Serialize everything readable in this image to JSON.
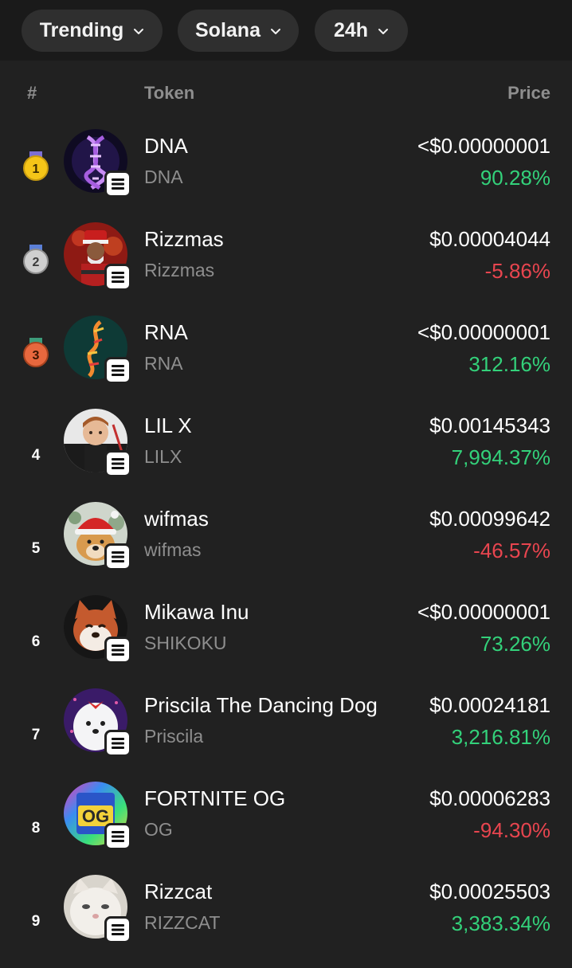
{
  "filters": {
    "sort": "Trending",
    "chain": "Solana",
    "period": "24h"
  },
  "columns": {
    "rank": "#",
    "token": "Token",
    "price": "Price"
  },
  "colors": {
    "positive": "#33d17a",
    "negative": "#e8454f",
    "gold": "#f5c518",
    "silver": "#bdbdbd",
    "bronze": "#e0663a"
  },
  "tokens": [
    {
      "rank": "1",
      "medal": "gold-medal-icon",
      "name": "DNA",
      "symbol": "DNA",
      "price": "<$0.00000001",
      "change": "90.28%",
      "direction": "up",
      "avatar": "dna-helix-icon"
    },
    {
      "rank": "2",
      "medal": "silver-medal-icon",
      "name": "Rizzmas",
      "symbol": "Rizzmas",
      "price": "$0.00004044",
      "change": "-5.86%",
      "direction": "down",
      "avatar": "santa-character-icon"
    },
    {
      "rank": "3",
      "medal": "bronze-medal-icon",
      "name": "RNA",
      "symbol": "RNA",
      "price": "<$0.00000001",
      "change": "312.16%",
      "direction": "up",
      "avatar": "rna-strand-icon"
    },
    {
      "rank": "4",
      "medal": "",
      "name": "LIL X",
      "symbol": "LILX",
      "price": "$0.00145343",
      "change": "7,994.37%",
      "direction": "up",
      "avatar": "child-photo-icon"
    },
    {
      "rank": "5",
      "medal": "",
      "name": "wifmas",
      "symbol": "wifmas",
      "price": "$0.00099642",
      "change": "-46.57%",
      "direction": "down",
      "avatar": "dog-santa-hat-icon"
    },
    {
      "rank": "6",
      "medal": "",
      "name": "Mikawa Inu",
      "symbol": "SHIKOKU",
      "price": "<$0.00000001",
      "change": "73.26%",
      "direction": "up",
      "avatar": "shiba-dog-icon"
    },
    {
      "rank": "7",
      "medal": "",
      "name": "Priscila The Dancing Dog",
      "symbol": "Priscila",
      "price": "$0.00024181",
      "change": "3,216.81%",
      "direction": "up",
      "avatar": "white-dog-icon"
    },
    {
      "rank": "8",
      "medal": "",
      "name": "FORTNITE OG",
      "symbol": "OG",
      "price": "$0.00006283",
      "change": "-94.30%",
      "direction": "down",
      "avatar": "fortnite-og-logo-icon"
    },
    {
      "rank": "9",
      "medal": "",
      "name": "Rizzcat",
      "symbol": "RIZZCAT",
      "price": "$0.00025503",
      "change": "3,383.34%",
      "direction": "up",
      "avatar": "cat-photo-icon"
    }
  ]
}
